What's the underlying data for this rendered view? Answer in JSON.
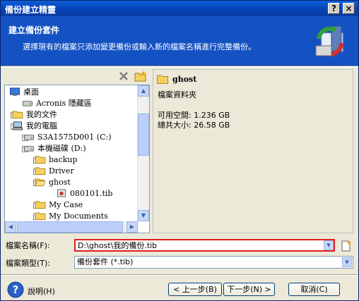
{
  "window": {
    "title": "備份建立精靈",
    "help_btn": "?",
    "close_btn": "×"
  },
  "header": {
    "title": "建立備份套件",
    "description": "選擇現有的檔案只添加變更備份或輸入新的檔案名稱進行完整備份。"
  },
  "tree": {
    "items": [
      {
        "label": "桌面",
        "icon": "desktop-icon",
        "expander": ""
      },
      {
        "label": "Acronis 隱藏區",
        "icon": "drive-icon",
        "expander": ""
      },
      {
        "label": "我的文件",
        "icon": "folder-icon",
        "expander": "+"
      },
      {
        "label": "我的電腦",
        "icon": "computer-icon",
        "expander": "-"
      },
      {
        "label": "S3A1575D001 (C:)",
        "icon": "drive-icon",
        "expander": "+"
      },
      {
        "label": "本機磁碟 (D:)",
        "icon": "drive-icon",
        "expander": "-"
      },
      {
        "label": "backup",
        "icon": "folder-icon",
        "expander": "+"
      },
      {
        "label": "Driver",
        "icon": "folder-icon",
        "expander": "+"
      },
      {
        "label": "ghost",
        "icon": "folder-open-icon",
        "expander": "-"
      },
      {
        "label": "080101.tib",
        "icon": "archive-icon",
        "expander": ""
      },
      {
        "label": "My Case",
        "icon": "folder-icon",
        "expander": "+"
      },
      {
        "label": "My Documents",
        "icon": "folder-icon",
        "expander": "+"
      }
    ]
  },
  "info": {
    "name": "ghost",
    "type": "檔案資料夾",
    "free_space": "可用空間: 1.236 GB",
    "total_size": "總共大小: 26.58 GB"
  },
  "form": {
    "filename_label": "檔案名稱(F):",
    "filename_value": "D:\\ghost\\我的備份.tib",
    "filetype_label": "檔案類型(T):",
    "filetype_value": "備份套件 (*.tib)"
  },
  "buttons": {
    "help": "說明(H)",
    "back": "< 上一步(B)",
    "next": "下一步(N) >",
    "cancel": "取消(C)"
  },
  "colors": {
    "header_bg": "#1452c4",
    "highlight_border": "#e02020",
    "folder": "#f5d060"
  }
}
